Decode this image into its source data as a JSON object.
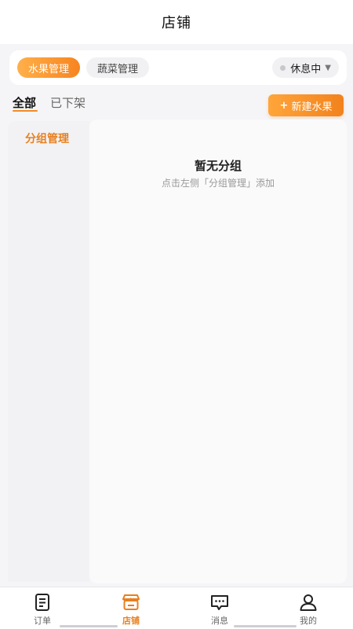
{
  "header": {
    "title": "店铺"
  },
  "segments": {
    "fruit_label": "水果管理",
    "veg_label": "蔬菜管理",
    "status_label": "休息中"
  },
  "tabs": {
    "all_label": "全部",
    "offshelf_label": "已下架"
  },
  "new_button": {
    "plus": "+",
    "label": "新建水果"
  },
  "sidebar": {
    "group_mgr_label": "分组管理"
  },
  "empty_state": {
    "title": "暂无分组",
    "subtitle": "点击左侧「分组管理」添加"
  },
  "tabbar": {
    "items": [
      {
        "label": "订单",
        "icon": "order-icon"
      },
      {
        "label": "店铺",
        "icon": "store-icon"
      },
      {
        "label": "消息",
        "icon": "message-icon"
      },
      {
        "label": "我的",
        "icon": "profile-icon"
      }
    ]
  },
  "colors": {
    "accent": "#f7841f",
    "active_text": "#e8801f"
  }
}
